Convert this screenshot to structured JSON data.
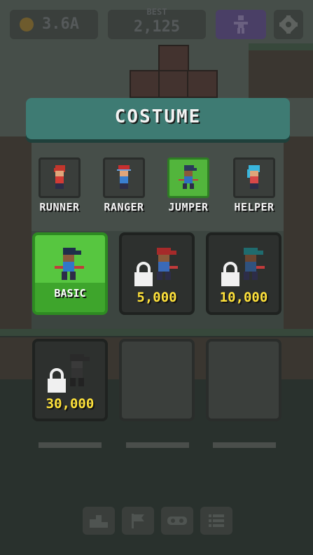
{
  "hud": {
    "coins": "3.6A",
    "best_label": "BEST",
    "best_value": "2,125",
    "character_icon": "person-icon",
    "settings_icon": "gear-icon",
    "coin_icon": "coin-icon"
  },
  "panel": {
    "title": "COSTUME"
  },
  "tabs": [
    {
      "label": "RUNNER",
      "selected": false,
      "hair": "#c2362c",
      "shirt": "#d23b35"
    },
    {
      "label": "RANGER",
      "selected": false,
      "hair": "#c62f2f",
      "shirt": "#3a7fd0"
    },
    {
      "label": "JUMPER",
      "selected": true,
      "hair": "#2a3a5a",
      "shirt": "#2f6fc2"
    },
    {
      "label": "HELPER",
      "selected": false,
      "hair": "#39b6dd",
      "shirt": "#d94848"
    }
  ],
  "costumes": [
    {
      "label": "BASIC",
      "locked": false,
      "selected": true,
      "hair": "#1f2f4a",
      "shirt": "#3078c8"
    },
    {
      "label": "5,000",
      "locked": true,
      "selected": false,
      "hair": "#a62a2a",
      "shirt": "#3a6ab8"
    },
    {
      "label": "10,000",
      "locked": true,
      "selected": false,
      "hair": "#1f6b6e",
      "shirt": "#30527e"
    },
    {
      "label": "30,000",
      "locked": true,
      "selected": false,
      "hair": "#2a2a2a",
      "shirt": "#3a3a3a"
    },
    {
      "label": "",
      "locked": false,
      "selected": false,
      "empty": true
    },
    {
      "label": "",
      "locked": false,
      "selected": false,
      "empty": true
    }
  ],
  "bottom_menu": {
    "icons": [
      "podium-icon",
      "flag-icon",
      "gamepad-icon",
      "list-icon"
    ]
  },
  "colors": {
    "tab_active": "#52b53c",
    "price_text": "#ffe23a",
    "title_banner": "#3e7b73"
  }
}
